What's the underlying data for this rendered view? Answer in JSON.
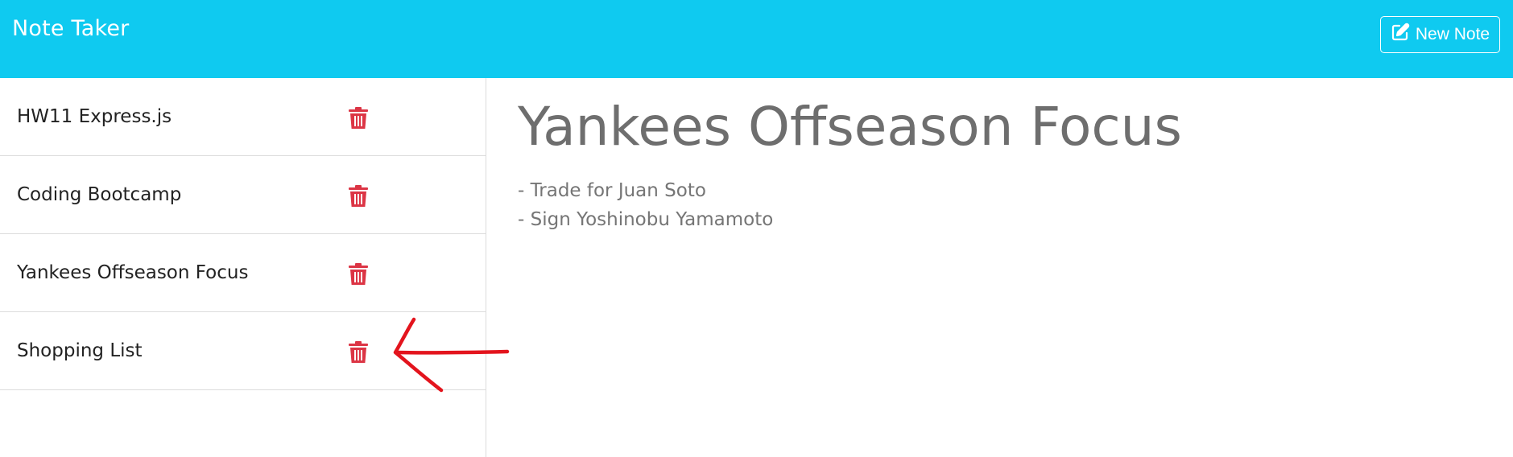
{
  "app": {
    "title": "Note Taker"
  },
  "toolbar": {
    "new_note_label": "New Note",
    "new_note_icon": "pencil-square-icon"
  },
  "notes": [
    {
      "title": "HW11 Express.js",
      "delete_icon": "trash-icon"
    },
    {
      "title": "Coding Bootcamp",
      "delete_icon": "trash-icon"
    },
    {
      "title": "Yankees Offseason Focus",
      "delete_icon": "trash-icon"
    },
    {
      "title": "Shopping List",
      "delete_icon": "trash-icon"
    }
  ],
  "active_note": {
    "title": "Yankees Offseason Focus",
    "lines": [
      "- Trade for Juan Soto",
      "- Sign Yoshinobu Yamamoto"
    ]
  },
  "colors": {
    "navbar": "#0fcaf0",
    "delete_icon": "#dc3545",
    "annotation_arrow": "#e3141d"
  }
}
